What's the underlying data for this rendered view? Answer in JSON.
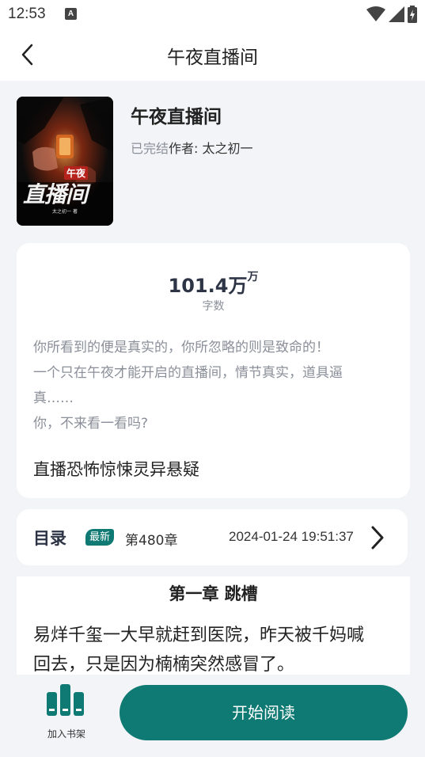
{
  "status_bar": {
    "time": "12:53",
    "notification_letter": "A",
    "icons": [
      "wifi-icon",
      "signal-icon",
      "battery-charging-icon"
    ]
  },
  "nav": {
    "title": "午夜直播间",
    "back_icon": "chevron-left-icon"
  },
  "book": {
    "title": "午夜直播间",
    "status": "已完结",
    "author": "作者: 太之初一",
    "cover": {
      "title_small": "午夜",
      "title_large": "直播间",
      "author_line": "太之初一 著"
    }
  },
  "stats": {
    "word_count": "101.4万",
    "word_unit": "万",
    "word_label": "字数"
  },
  "description": {
    "lines": [
      "你所看到的便是真实的，你所忽略的则是致命的！",
      "一个只在午夜才能开启的直播间，情节真实，道具逼",
      "真……",
      "你，不来看一看吗?"
    ]
  },
  "tags": "直播恐怖惊悚灵异悬疑",
  "toc": {
    "label": "目录",
    "badge": "最新",
    "latest_chapter": "第480章",
    "update_time": "2024-01-24 19:51:37"
  },
  "preview": {
    "chapter_title": "第一章 跳槽",
    "lines": [
      "易烊千玺一大早就赶到医院，昨天被千妈喊",
      "回去，只是因为楠楠突然感冒了。"
    ]
  },
  "bottom": {
    "shelf_label": "加入书架",
    "read_label": "开始阅读"
  },
  "colors": {
    "accent": "#0f7a73",
    "background": "#f3f4f7",
    "muted_text": "#8a8f99",
    "heading_text": "#2d3445"
  }
}
